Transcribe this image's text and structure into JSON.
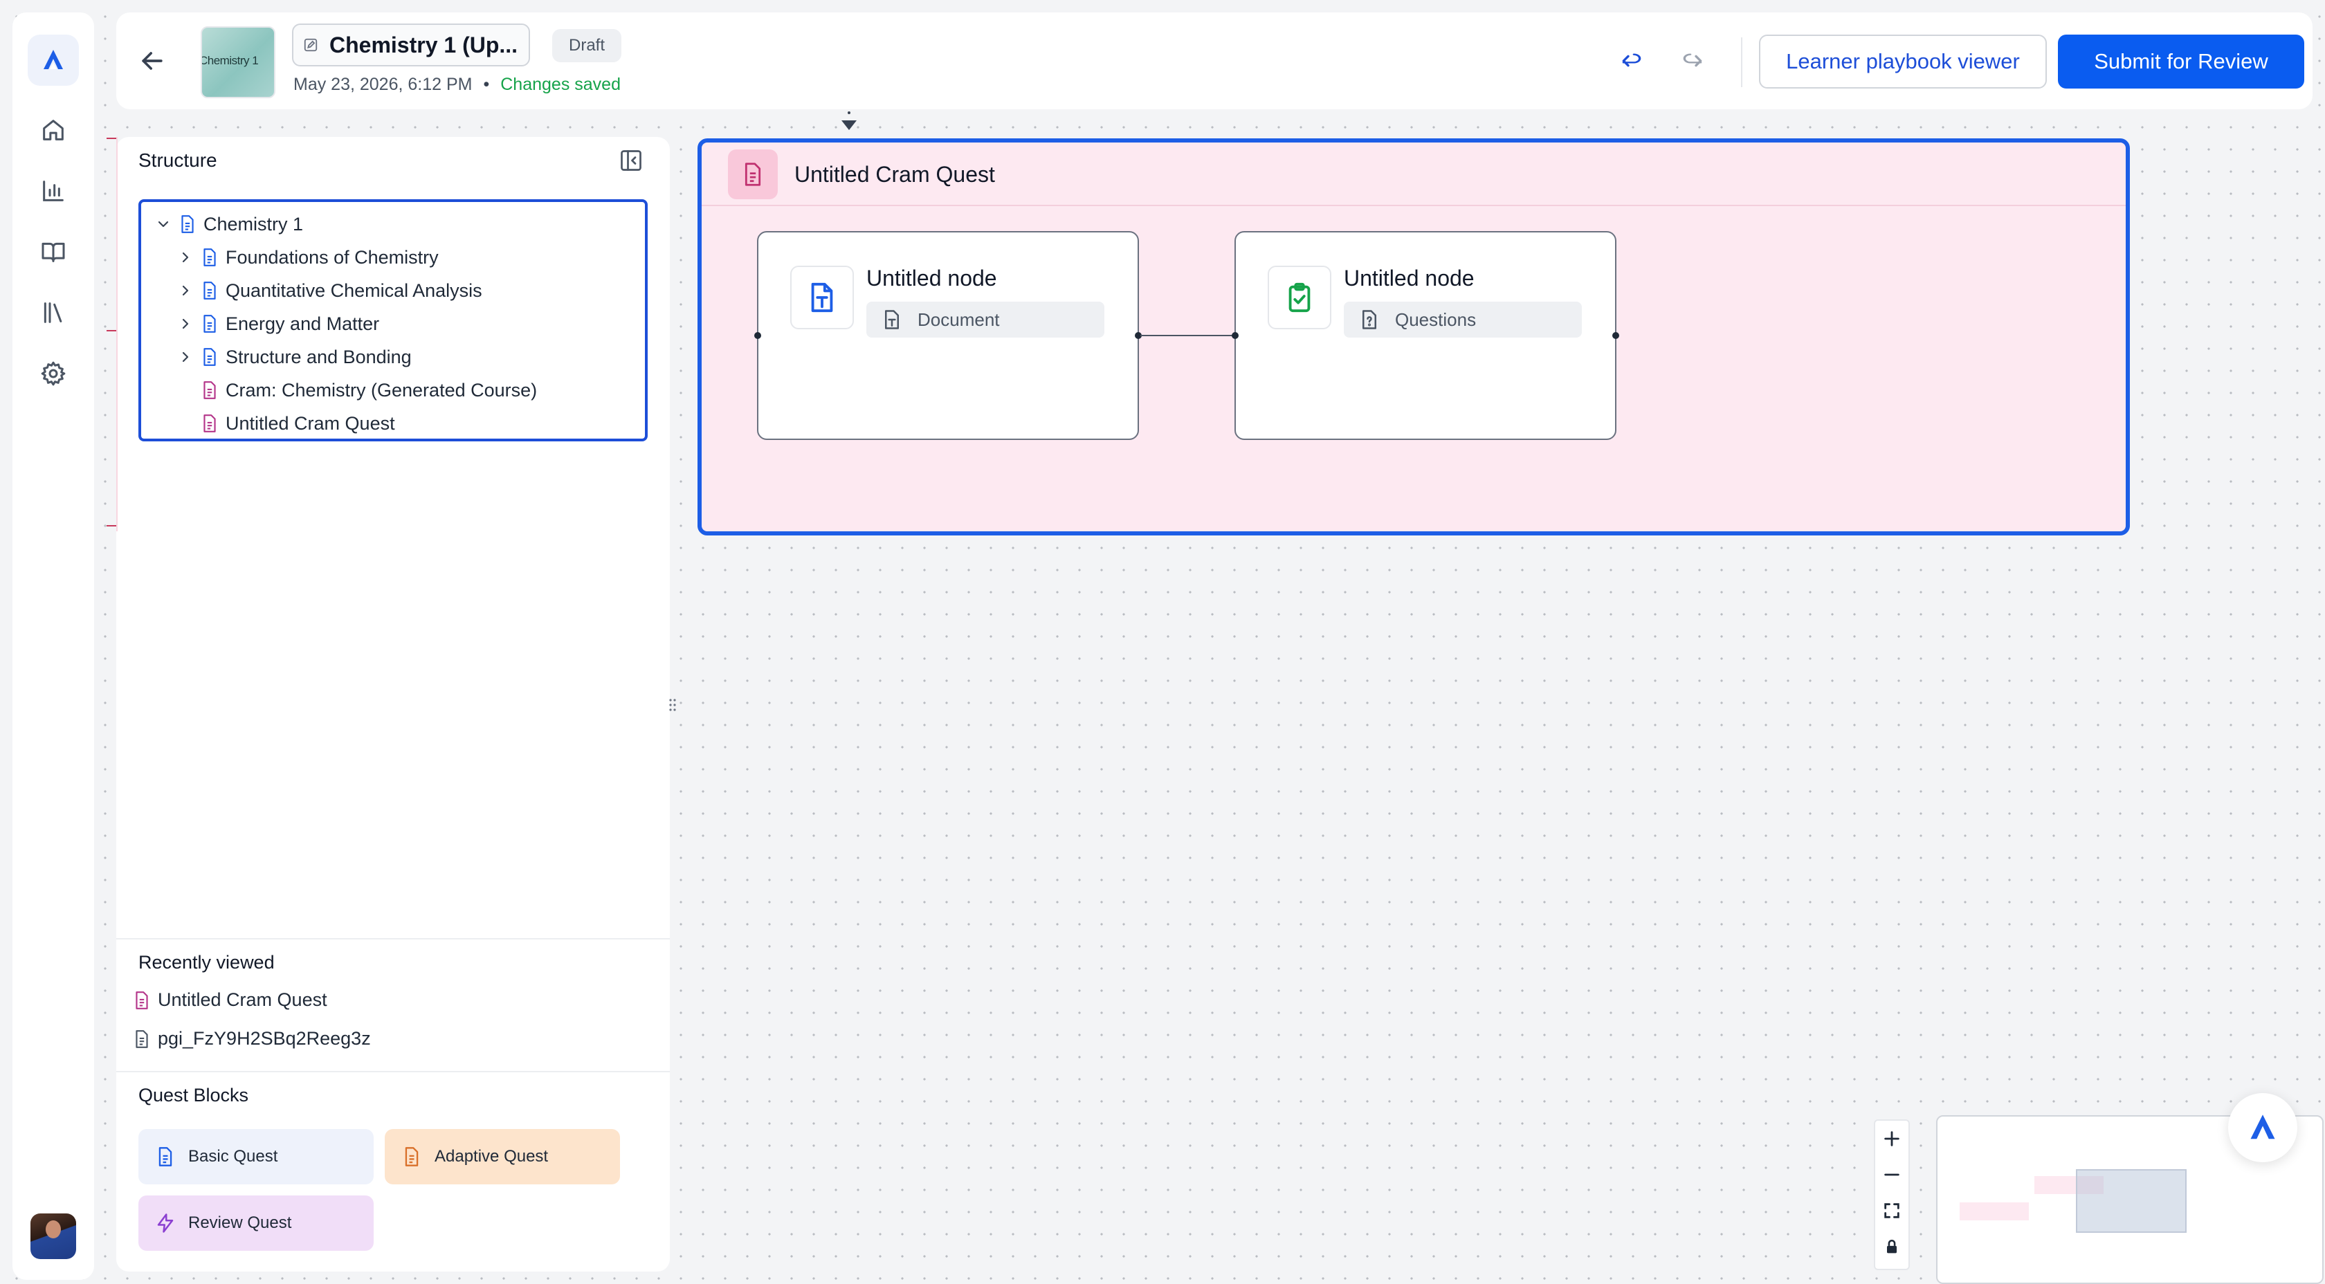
{
  "header": {
    "thumbnail_text": "Chemistry 1",
    "title": "Chemistry 1 (Up...",
    "status_badge": "Draft",
    "timestamp": "May 23, 2026, 6:12 PM",
    "separator": "•",
    "save_status": "Changes saved",
    "viewer_button": "Learner playbook viewer",
    "submit_button": "Submit for Review"
  },
  "structure": {
    "title": "Structure",
    "tree": [
      {
        "label": "Chemistry 1",
        "level": 0,
        "expandable": true,
        "expanded": true,
        "icon": "document-icon",
        "color": "#1d5ee6"
      },
      {
        "label": "Foundations of Chemistry",
        "level": 1,
        "expandable": true,
        "expanded": false,
        "icon": "document-icon",
        "color": "#1d5ee6"
      },
      {
        "label": "Quantitative Chemical Analysis",
        "level": 1,
        "expandable": true,
        "expanded": false,
        "icon": "document-icon",
        "color": "#1d5ee6"
      },
      {
        "label": "Energy and Matter",
        "level": 1,
        "expandable": true,
        "expanded": false,
        "icon": "document-icon",
        "color": "#1d5ee6"
      },
      {
        "label": "Structure and Bonding",
        "level": 1,
        "expandable": true,
        "expanded": false,
        "icon": "document-icon",
        "color": "#1d5ee6"
      },
      {
        "label": "Cram: Chemistry (Generated Course)",
        "level": 1,
        "expandable": false,
        "icon": "document-icon",
        "color": "#b4368a"
      },
      {
        "label": "Untitled Cram Quest",
        "level": 1,
        "expandable": false,
        "icon": "document-icon",
        "color": "#b4368a"
      }
    ]
  },
  "recently_viewed": {
    "title": "Recently viewed",
    "items": [
      {
        "label": "Untitled Cram Quest",
        "icon": "document-icon",
        "color": "#b4368a"
      },
      {
        "label": "pgi_FzY9H2SBq2Reeg3z",
        "icon": "document-icon",
        "color": "#4b5563"
      }
    ]
  },
  "quest_blocks": {
    "title": "Quest Blocks",
    "basic": "Basic Quest",
    "adaptive": "Adaptive Quest",
    "review": "Review Quest"
  },
  "canvas": {
    "quest_title": "Untitled Cram Quest",
    "nodes": [
      {
        "title": "Untitled node",
        "type": "Document",
        "icon": "text-document-icon",
        "accent": "#1d5ee6"
      },
      {
        "title": "Untitled node",
        "type": "Questions",
        "icon": "clipboard-check-icon",
        "accent": "#16a34a"
      }
    ]
  },
  "colors": {
    "accent": "#1d5ee6",
    "primary_button": "#0a5cf0",
    "saved_green": "#16a34a",
    "quest_bg": "#fde9f1"
  }
}
